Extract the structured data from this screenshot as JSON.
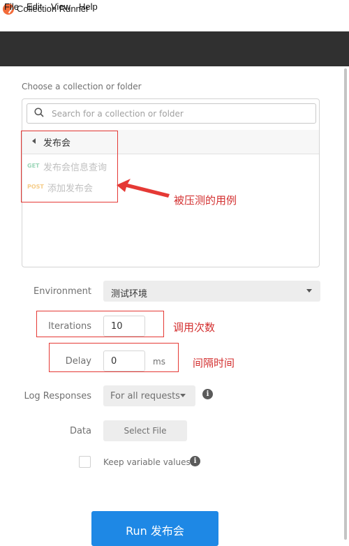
{
  "window": {
    "title": "Collection Runner"
  },
  "menubar": {
    "items": [
      "File",
      "Edit",
      "View",
      "Help"
    ]
  },
  "header": {
    "title": "Collection Runner"
  },
  "collection": {
    "label": "Choose a collection or folder",
    "search_placeholder": "Search for a collection or folder",
    "folder": "发布会",
    "requests": [
      {
        "method": "GET",
        "name": "发布会信息查询",
        "method_color": "#9bd6b8"
      },
      {
        "method": "POST",
        "name": "添加发布会",
        "method_color": "#f5cd8a"
      }
    ]
  },
  "form": {
    "environment": {
      "label": "Environment",
      "value": "测试环境"
    },
    "iterations": {
      "label": "Iterations",
      "value": "10"
    },
    "delay": {
      "label": "Delay",
      "value": "0",
      "unit": "ms"
    },
    "log_responses": {
      "label": "Log Responses",
      "value": "For all requests"
    },
    "data": {
      "label": "Data",
      "button": "Select File"
    },
    "keep_variables": {
      "label": "Keep variable values",
      "checked": false
    }
  },
  "run_button": {
    "label": "Run 发布会",
    "color": "#1e88e5"
  },
  "annotations": {
    "requests_note": "被压测的用例",
    "iterations_note": "调用次数",
    "delay_note": "间隔时间",
    "color": "#e53935"
  },
  "icons": {
    "search": "search-icon",
    "back": "triangle-left-icon",
    "info": "info-icon",
    "app": "postman-icon",
    "caret": "caret-down-icon"
  }
}
